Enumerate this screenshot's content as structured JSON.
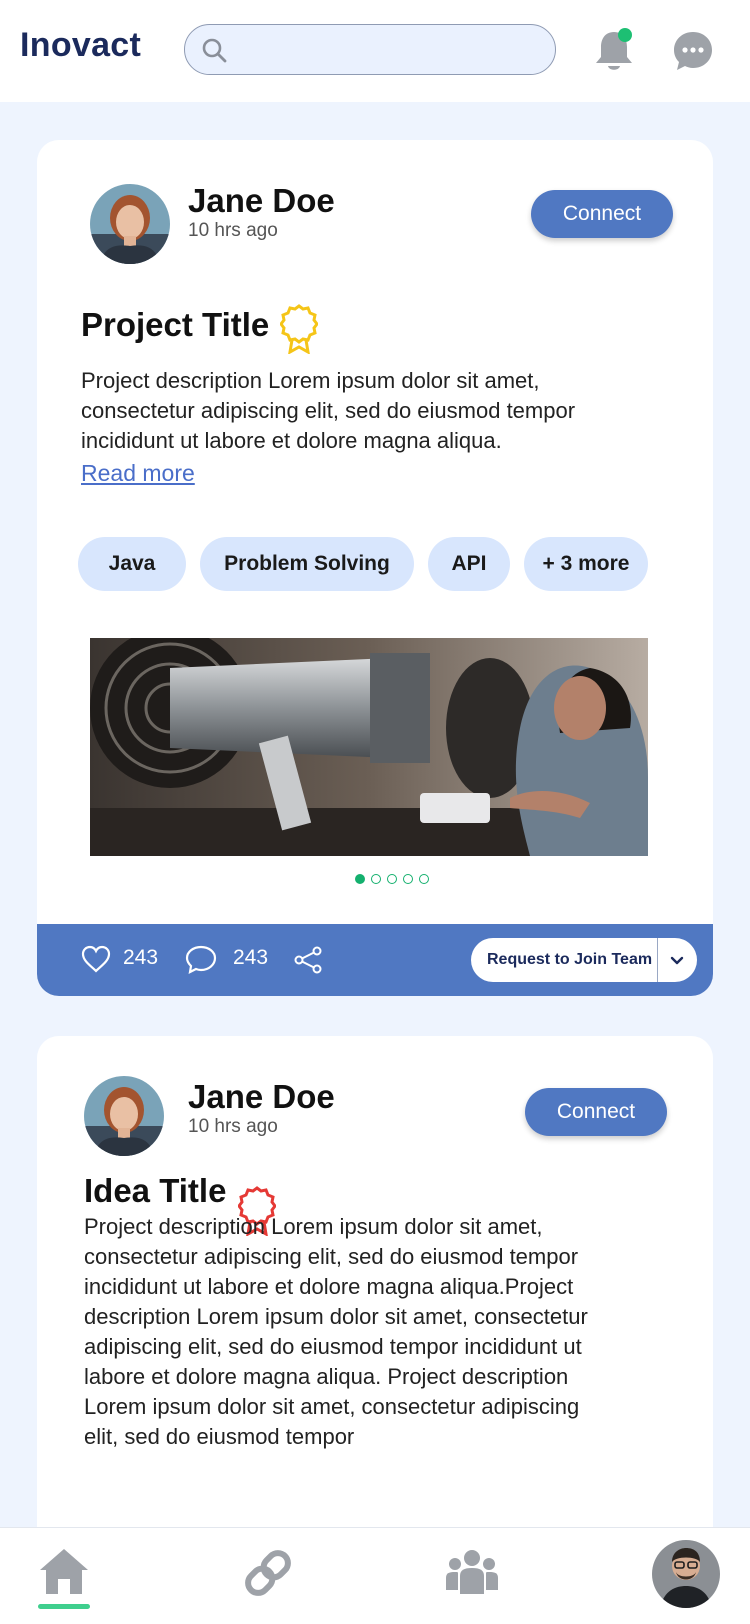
{
  "app": {
    "title": "Inovact"
  },
  "search": {
    "placeholder": "",
    "value": ""
  },
  "header": {
    "notification_badge_color": "#1dbf73"
  },
  "posts": [
    {
      "author": "Jane Doe",
      "time": "10 hrs ago",
      "connect_label": "Connect",
      "title": "Project Title",
      "badge_color": "#f5c518",
      "description": "Project description Lorem ipsum dolor sit amet, consectetur adipiscing elit, sed do eiusmod tempor incididunt ut labore et dolore magna aliqua.",
      "read_more": "Read more",
      "tags": [
        "Java",
        "Problem Solving",
        "API",
        "+ 3 more"
      ],
      "carousel": {
        "total": 5,
        "active": 1
      },
      "likes": "243",
      "comments": "243",
      "join_label": "Request to Join Team"
    },
    {
      "author": "Jane Doe",
      "time": "10 hrs ago",
      "connect_label": "Connect",
      "title": "Idea Title",
      "badge_color": "#e53935",
      "description": "Project description Lorem ipsum dolor sit amet, consectetur adipiscing elit, sed do eiusmod tempor incididunt ut labore et dolore magna aliqua.Project description Lorem ipsum dolor sit amet, consectetur adipiscing elit, sed do eiusmod tempor incididunt ut labore et dolore magna aliqua. Project description Lorem ipsum dolor sit amet, consectetur adipiscing elit, sed do eiusmod tempor"
    }
  ],
  "bottom_nav": {
    "items": [
      "home-icon",
      "link-icon",
      "team-icon",
      "profile-avatar"
    ],
    "active": "home-icon",
    "accent": "#3fcf8e"
  }
}
